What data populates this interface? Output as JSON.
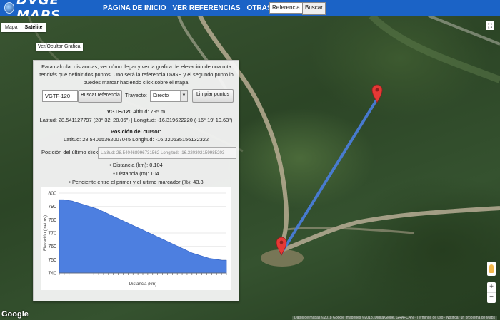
{
  "header": {
    "logo": "DVGE MAPS",
    "nav": [
      "PÁGINA DE INICIO",
      "VER REFERENCIAS",
      "OTRAS OPCIONES"
    ],
    "search_value": "Referencia...",
    "search_button": "Buscar"
  },
  "map": {
    "type_buttons": [
      "Mapa",
      "Satélite"
    ],
    "selected_type": "Satélite",
    "toggle_label": "Ver/Ocultar Grafica",
    "google_label": "Google",
    "attribution": "Datos de mapas ©2018 Google Imágenes ©2018, DigitalGlobe, GRAFCAN · Términos de uso · Notificar un problema de Maps"
  },
  "panel": {
    "intro": "Para calcular distancias, ver cómo llegar y ver la grafica de elevación de una ruta tendrás que definir dos puntos. Uno será la referencia DVGE y el segundo punto lo puedes marcar haciendo click sobre el mapa.",
    "reference_input": "VGTF-120",
    "search_button": "Buscar referencia",
    "trayecto_label": "Trayecto:",
    "trayecto_value": "Directo",
    "clear_button": "Limpiar puntos",
    "ref_title": "VGTF-120",
    "ref_altitude": " Altitud: 795 m",
    "ref_coords": "Latitud: 28.541127797 (28° 32' 28.06\") | Longitud: -16.319622220 (-16° 19' 10.63\")",
    "cursor_title": "Posición del cursor:",
    "cursor_coords": "Latitud: 28.54065362007045 Longitud: -16.320635156132322",
    "last_click_label": "Posición del último click:",
    "last_click_value": "Latitud: 28.540468996731562 Longitud: -16.320302159985203",
    "distance_km": "• Distancia (km): 0.104",
    "distance_m": "• Distancia (m): 104",
    "slope": "• Pendiente entre el primer y el último marcador (%): 43.3"
  },
  "chart_data": {
    "type": "area",
    "xlabel": "Distancia (km)",
    "ylabel": "Elevación (metros)",
    "ylim": [
      740,
      800
    ],
    "yticks": [
      740,
      750,
      760,
      770,
      780,
      790,
      800
    ],
    "series": [
      {
        "values": [
          795,
          795,
          794.5,
          794,
          793,
          792,
          791,
          790,
          789,
          788,
          786.5,
          785,
          783.5,
          782,
          780.5,
          779,
          777.5,
          776,
          774.5,
          773,
          771.5,
          770,
          768.5,
          767,
          765.5,
          764,
          762.5,
          761,
          759.5,
          758,
          756.5,
          755,
          754,
          753,
          752,
          751,
          750.5,
          750,
          749.5,
          749.5
        ]
      }
    ],
    "color": "#4d7fe0",
    "grid": true
  },
  "colors": {
    "header": "#1b63c6",
    "route": "#4a7fe0",
    "marker": "#e53935"
  }
}
